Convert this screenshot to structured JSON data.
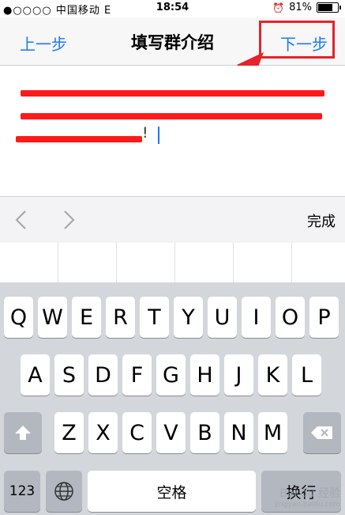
{
  "status_bar": {
    "carrier": "●○○○○ 中国移动  E",
    "time": "18:54",
    "battery": "81%",
    "battery_level": 0.81
  },
  "nav": {
    "back_label": "上一步",
    "title": "填写群介绍",
    "next_label": "下一步"
  },
  "text_area": {
    "end_char": "!"
  },
  "toolbar": {
    "prev_icon": "chevron-left-icon",
    "next_icon": "chevron-right-icon",
    "done_label": "完成"
  },
  "keyboard": {
    "row1": [
      "Q",
      "W",
      "E",
      "R",
      "T",
      "Y",
      "U",
      "I",
      "O",
      "P"
    ],
    "row2": [
      "A",
      "S",
      "D",
      "F",
      "G",
      "H",
      "J",
      "K",
      "L"
    ],
    "row3": [
      "Z",
      "X",
      "C",
      "V",
      "B",
      "N",
      "M"
    ],
    "numbers_label": "123",
    "space_label": "空格",
    "return_label": "换行"
  },
  "watermark": {
    "brand": "Bai du 经验",
    "url": "jingyan.baidu.com"
  },
  "colors": {
    "accent": "#1a78ff",
    "highlight": "#e4232b",
    "redaction": "#ff1a1a"
  }
}
